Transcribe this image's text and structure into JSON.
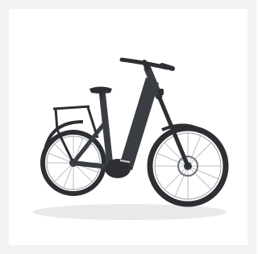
{
  "image": {
    "subject": "e-bike",
    "background_color": "#ffffff",
    "frame_color": "#f2f2f2",
    "bike_color": "#3a3d42"
  }
}
